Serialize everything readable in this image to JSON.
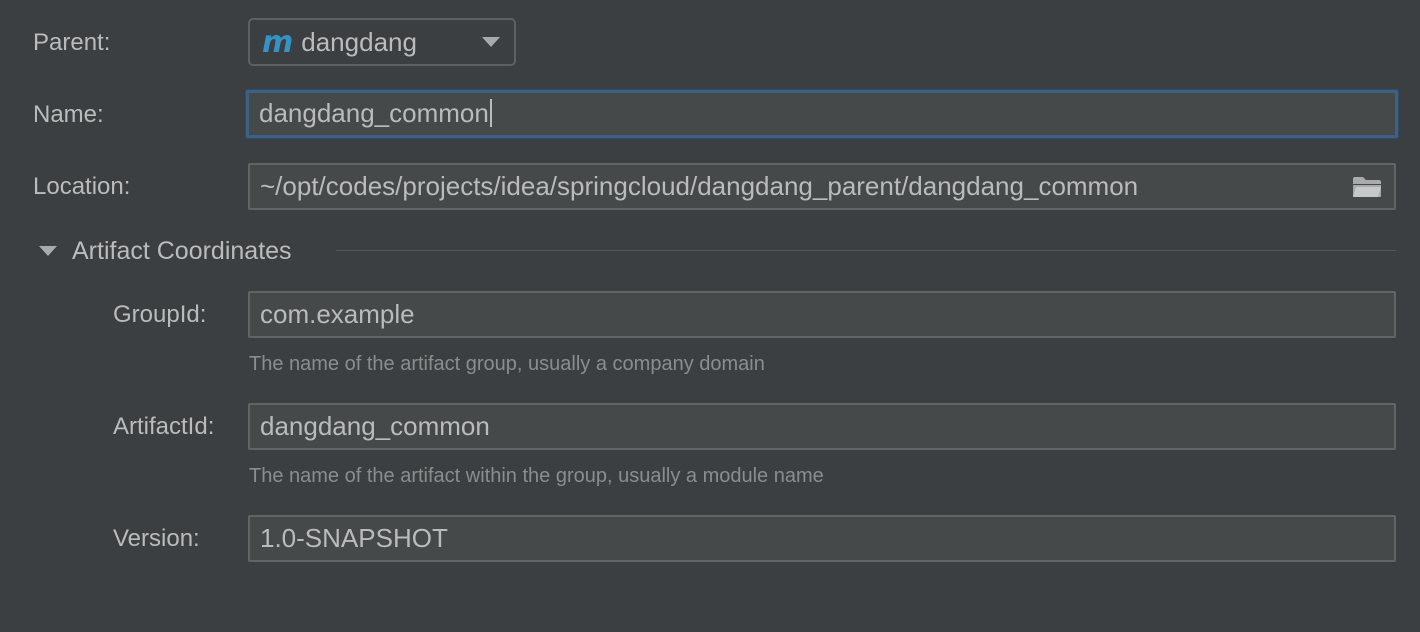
{
  "form": {
    "parent": {
      "label": "Parent:",
      "icon": "maven-module-icon",
      "icon_glyph": "m",
      "value": "dangdang"
    },
    "name": {
      "label": "Name:",
      "value": "dangdang_common"
    },
    "location": {
      "label": "Location:",
      "value": "~/opt/codes/projects/idea/springcloud/dangdang_parent/dangdang_common"
    }
  },
  "artifact_coordinates": {
    "title": "Artifact Coordinates",
    "expanded": true,
    "group_id": {
      "label": "GroupId:",
      "value": "com.example",
      "hint": "The name of the artifact group, usually a company domain"
    },
    "artifact_id": {
      "label": "ArtifactId:",
      "value": "dangdang_common",
      "hint": "The name of the artifact within the group, usually a module name"
    },
    "version": {
      "label": "Version:",
      "value": "1.0-SNAPSHOT"
    }
  },
  "colors": {
    "background": "#3c3f41",
    "field_background": "#45494a",
    "focus_border": "#3d6185",
    "maven_icon": "#3592c4",
    "text": "#bbbbbb",
    "hint_text": "#8c8c8c"
  }
}
